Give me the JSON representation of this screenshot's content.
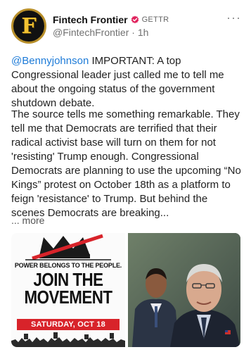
{
  "author": {
    "display_name": "Fintech Frontier",
    "platform": "GETTR",
    "handle": "@FintechFrontier",
    "time": "1h",
    "avatar_icon": "fintech-frontier-f-logo",
    "verified_icon": "red-check-badge"
  },
  "menu_icon": "more-dots-icon",
  "post": {
    "mention": "@Bennyjohnson",
    "para1_rest": " IMPORTANT: A top Congressional leader just called me to tell me about the ongoing status of the government shutdown debate.",
    "para2": "The source tells me something remarkable. They tell me that Democrats are terrified that their radical activist base will turn on them for not 'resisting' Trump enough. Congressional Democrats are planning to use the upcoming “No Kings” protest on October 18th as a platform to feign 'resistance' to Trump. But behind the scenes Democrats are breaking...",
    "more_label": "... more"
  },
  "media": {
    "poster": {
      "tagline": "POWER BELONGS TO THE PEOPLE.",
      "headline": "JOIN THE MOVEMENT",
      "date": "SATURDAY, OCT 18"
    }
  },
  "colors": {
    "mention": "#1d7bd8",
    "badge": "#e0245e",
    "banner": "#d8232a",
    "avatar_gold": "#f2c232"
  }
}
